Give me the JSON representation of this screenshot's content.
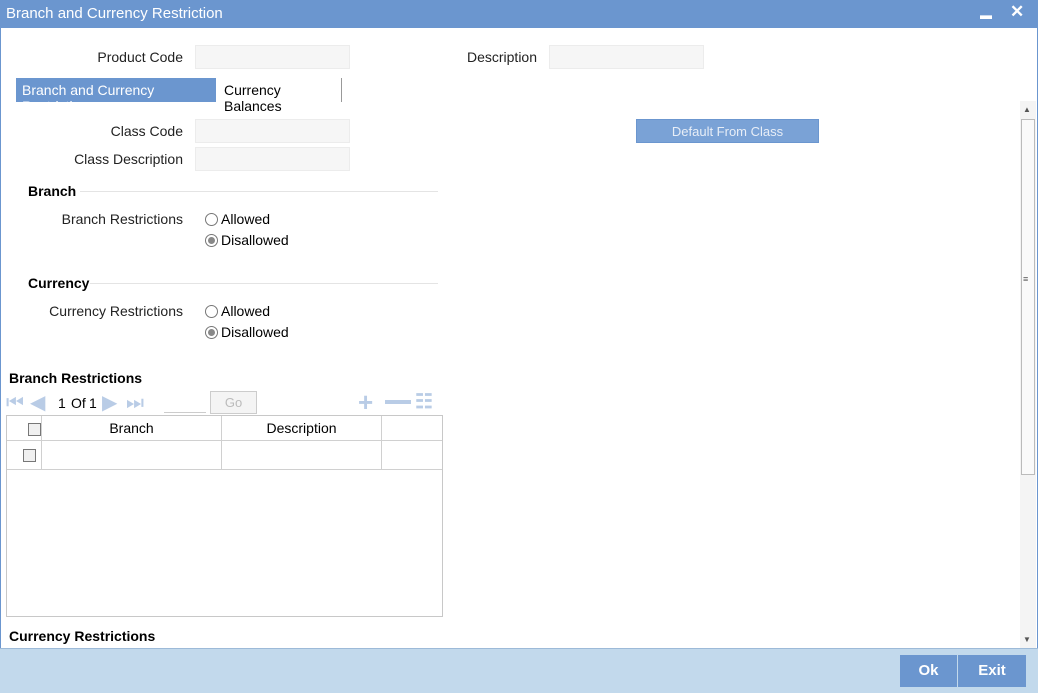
{
  "window": {
    "title": "Branch and Currency Restriction",
    "minimize_glyph": "▬",
    "close_glyph": "✕"
  },
  "header": {
    "product_code_label": "Product Code",
    "product_code_value": "",
    "description_label": "Description",
    "description_value": ""
  },
  "tabs": [
    {
      "label": "Branch and Currency Restriction",
      "active": true
    },
    {
      "label": "Currency Balances",
      "active": false
    }
  ],
  "class_info": {
    "class_code_label": "Class Code",
    "class_code_value": "",
    "class_description_label": "Class Description",
    "class_description_value": "",
    "default_button": "Default From Class"
  },
  "branch_section": {
    "heading": "Branch",
    "field_label": "Branch Restrictions",
    "options": [
      "Allowed",
      "Disallowed"
    ],
    "selected": "Disallowed"
  },
  "currency_section": {
    "heading": "Currency",
    "field_label": "Currency Restrictions",
    "options": [
      "Allowed",
      "Disallowed"
    ],
    "selected": "Disallowed"
  },
  "branch_grid": {
    "title": "Branch Restrictions",
    "pager": {
      "current": "1",
      "of_label": "Of",
      "total": "1",
      "go_label": "Go"
    },
    "columns": [
      "Branch",
      "Description"
    ],
    "rows": [
      {
        "branch": "",
        "description": ""
      }
    ]
  },
  "currency_grid": {
    "title": "Currency Restrictions"
  },
  "footer": {
    "ok_label": "Ok",
    "exit_label": "Exit"
  },
  "colors": {
    "accent": "#6b96cf",
    "footer_bg": "#c2d9ec"
  }
}
